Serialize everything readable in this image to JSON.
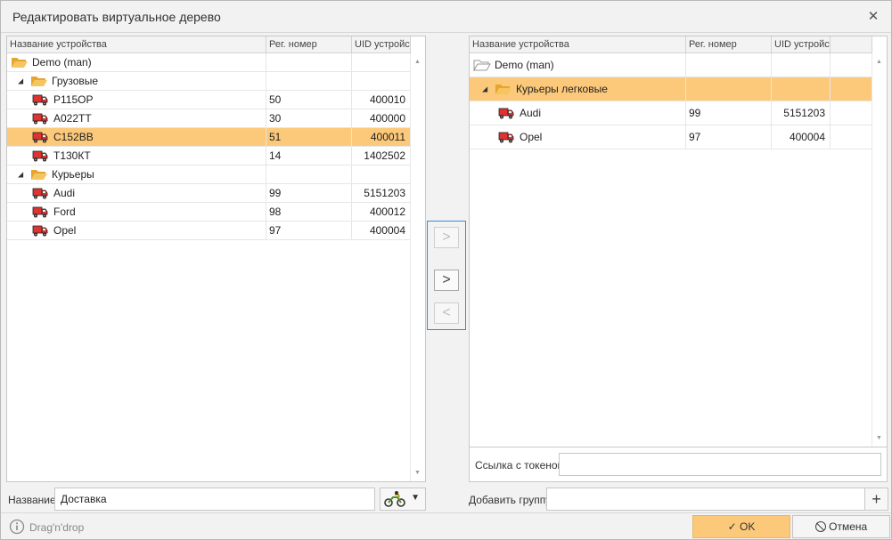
{
  "dialog": {
    "title": "Редактировать виртуальное дерево"
  },
  "left_table": {
    "headers": [
      "Название устройства",
      "Рег. номер",
      "UID устройства"
    ],
    "rows": [
      {
        "type": "group",
        "level": 0,
        "name": "Demo (man)",
        "reg": "",
        "uid": ""
      },
      {
        "type": "group",
        "level": 1,
        "name": "Грузовые",
        "reg": "",
        "uid": "",
        "expanded": true
      },
      {
        "type": "device",
        "level": 2,
        "name": "Р115ОР",
        "reg": "50",
        "uid": "400010"
      },
      {
        "type": "device",
        "level": 2,
        "name": "А022ТТ",
        "reg": "30",
        "uid": "400000"
      },
      {
        "type": "device",
        "level": 2,
        "name": "С152ВВ",
        "reg": "51",
        "uid": "400011",
        "selected": true
      },
      {
        "type": "device",
        "level": 2,
        "name": "Т130КТ",
        "reg": "14",
        "uid": "1402502"
      },
      {
        "type": "group",
        "level": 1,
        "name": "Курьеры",
        "reg": "",
        "uid": "",
        "expanded": true
      },
      {
        "type": "device",
        "level": 2,
        "name": "Audi",
        "reg": "99",
        "uid": "5151203"
      },
      {
        "type": "device",
        "level": 2,
        "name": "Ford",
        "reg": "98",
        "uid": "400012"
      },
      {
        "type": "device",
        "level": 2,
        "name": "Opel",
        "reg": "97",
        "uid": "400004"
      }
    ]
  },
  "right_table": {
    "headers": [
      "Название устройства",
      "Рег. номер",
      "UID устройства"
    ],
    "rows": [
      {
        "type": "root",
        "level": 0,
        "name": "Demo (man)",
        "reg": "",
        "uid": ""
      },
      {
        "type": "group",
        "level": 1,
        "name": "Курьеры легковые",
        "reg": "",
        "uid": "",
        "expanded": true,
        "selected": true
      },
      {
        "type": "device",
        "level": 2,
        "name": "Audi",
        "reg": "99",
        "uid": "5151203"
      },
      {
        "type": "device",
        "level": 2,
        "name": "Opel",
        "reg": "97",
        "uid": "400004"
      }
    ]
  },
  "transfer": {
    "add_label": ">",
    "move_label": ">",
    "remove_label": "<"
  },
  "form": {
    "name_label": "Название",
    "name_value": "Доставка",
    "token_label": "Ссылка с токеном",
    "token_value": "",
    "add_group_label": "Добавить группу",
    "add_group_value": "",
    "plus": "+",
    "dropdown_arrow": "▼"
  },
  "footer": {
    "hint": "Drag'n'drop",
    "ok_label": "OK",
    "cancel_label": "Отмена"
  },
  "colors": {
    "selection": "#fcc97a",
    "folder": "#f3b53f",
    "accent": "#3b8ad8"
  }
}
